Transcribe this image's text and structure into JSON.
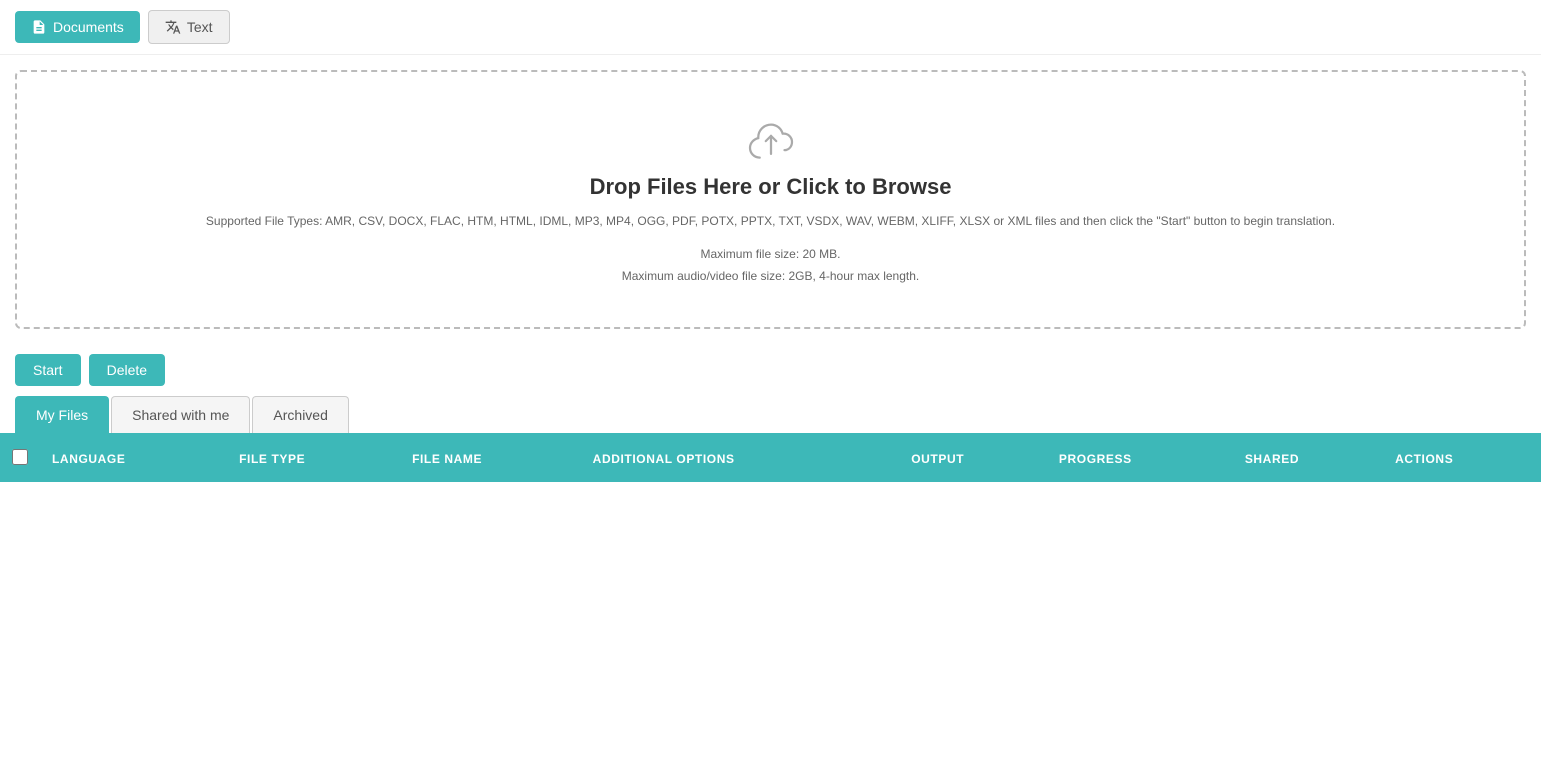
{
  "toolbar": {
    "documents_label": "Documents",
    "text_label": "Text"
  },
  "dropzone": {
    "title": "Drop Files Here or Click to Browse",
    "supported_label": "Supported File Types: AMR, CSV, DOCX, FLAC, HTM, HTML, IDML, MP3, MP4, OGG, PDF, POTX, PPTX, TXT, VSDX, WAV, WEBM, XLIFF, XLSX or XML files and then click the \"Start\" button to begin translation.",
    "max_file_size": "Maximum file size: 20 MB.",
    "max_audio": "Maximum audio/video file size: 2GB, 4-hour max length."
  },
  "actions": {
    "start_label": "Start",
    "delete_label": "Delete"
  },
  "tabs": [
    {
      "id": "my-files",
      "label": "My Files",
      "active": true
    },
    {
      "id": "shared-with-me",
      "label": "Shared with me",
      "active": false
    },
    {
      "id": "archived",
      "label": "Archived",
      "active": false
    }
  ],
  "table": {
    "columns": [
      {
        "key": "checkbox",
        "label": ""
      },
      {
        "key": "language",
        "label": "LANGUAGE"
      },
      {
        "key": "file_type",
        "label": "FILE TYPE"
      },
      {
        "key": "file_name",
        "label": "FILE NAME"
      },
      {
        "key": "additional_options",
        "label": "ADDITIONAL OPTIONS"
      },
      {
        "key": "output",
        "label": "OUTPUT"
      },
      {
        "key": "progress",
        "label": "PROGRESS"
      },
      {
        "key": "shared",
        "label": "SHARED"
      },
      {
        "key": "actions",
        "label": "ACTIONS"
      }
    ],
    "rows": []
  },
  "colors": {
    "primary": "#3db8b8",
    "text_secondary": "#666",
    "border": "#bbb"
  }
}
